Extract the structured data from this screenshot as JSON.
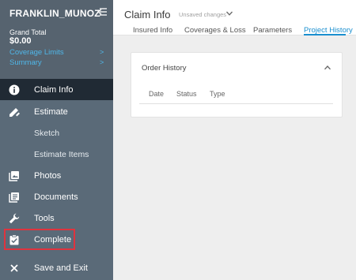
{
  "sidebar": {
    "user_name": "FRANKLIN_MUNOZ",
    "grand_total_label": "Grand Total",
    "grand_total_value": "$0.00",
    "links": [
      {
        "label": "Coverage Limits",
        "chevron": ">"
      },
      {
        "label": "Summary",
        "chevron": ">"
      }
    ],
    "nav": {
      "claim_info": "Claim Info",
      "estimate": "Estimate",
      "sketch": "Sketch",
      "estimate_items": "Estimate Items",
      "photos": "Photos",
      "documents": "Documents",
      "tools": "Tools",
      "complete": "Complete",
      "save_exit": "Save and Exit"
    },
    "colors": {
      "background": "#5a6a78",
      "active": "#202a34",
      "link": "#4fb6e8",
      "highlight": "#e0333e"
    }
  },
  "header": {
    "title": "Claim Info",
    "status": "Unsaved changes",
    "tabs": [
      "Insured Info",
      "Coverages & Loss",
      "Parameters",
      "Project History"
    ],
    "active_tab": "Project History"
  },
  "order_history": {
    "title": "Order History",
    "columns": [
      "Date",
      "Status",
      "Type"
    ]
  },
  "colors": {
    "accent": "#1a8fcf"
  }
}
